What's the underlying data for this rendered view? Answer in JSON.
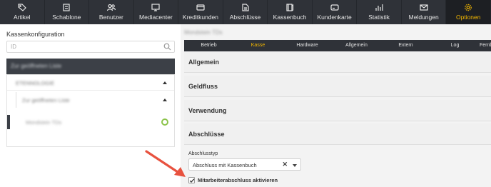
{
  "nav": {
    "items": [
      {
        "label": "Artikel",
        "icon": "tag-icon"
      },
      {
        "label": "Schablone",
        "icon": "layers-icon"
      },
      {
        "label": "Benutzer",
        "icon": "users-icon"
      },
      {
        "label": "Mediacenter",
        "icon": "monitor-icon"
      },
      {
        "label": "Kreditkunden",
        "icon": "credit-card-icon"
      },
      {
        "label": "Abschlüsse",
        "icon": "document-icon"
      },
      {
        "label": "Kassenbuch",
        "icon": "book-icon"
      },
      {
        "label": "Kundenkarte",
        "icon": "card-icon"
      },
      {
        "label": "Statistik",
        "icon": "chart-icon"
      },
      {
        "label": "Meldungen",
        "icon": "mail-icon"
      },
      {
        "label": "Optionen",
        "icon": "gear-icon"
      }
    ],
    "active_index": 10,
    "active_color": "#f2b600"
  },
  "sidebar": {
    "title": "Kassenkonfiguration",
    "search_placeholder": "ID",
    "tree": {
      "selected_label": "Zur geöffneten Liste",
      "level1_label": "ETENNOLOGIE",
      "level2_label": "Zur geöffneten Liste",
      "level3_label": "Mondstein TDs"
    }
  },
  "main": {
    "breadcrumb": "Mondstein TDs",
    "tabs": [
      "Betrieb",
      "Kasse",
      "Hardware",
      "Allgemein",
      "Extern",
      "Log",
      "Fernbe"
    ],
    "active_tab": "Kasse",
    "sections": [
      "Allgemein",
      "Geldfluss",
      "Verwendung",
      "Abschlüsse"
    ],
    "abschlusstyp_label": "Abschlusstyp",
    "abschlusstyp_value": "Abschluss mit Kassenbuch",
    "clear_symbol": "✕",
    "checkbox_label": "Mitarbeiterabschluss aktivieren",
    "checkbox_checked": true
  },
  "annotation": {
    "arrow_color": "#e8523f"
  }
}
